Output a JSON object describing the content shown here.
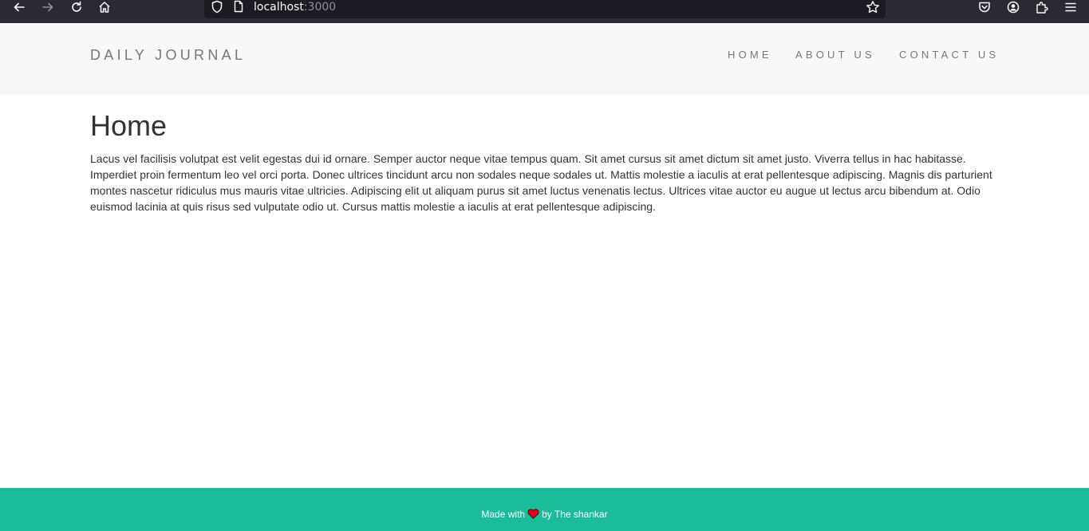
{
  "browser": {
    "url_host": "localhost",
    "url_port": ":3000"
  },
  "site": {
    "brand": "DAILY JOURNAL",
    "nav": [
      {
        "label": "HOME"
      },
      {
        "label": "ABOUT US"
      },
      {
        "label": "CONTACT US"
      }
    ]
  },
  "main": {
    "title": "Home",
    "body": "Lacus vel facilisis volutpat est velit egestas dui id ornare. Semper auctor neque vitae tempus quam. Sit amet cursus sit amet dictum sit amet justo. Viverra tellus in hac habitasse. Imperdiet proin fermentum leo vel orci porta. Donec ultrices tincidunt arcu non sodales neque sodales ut. Mattis molestie a iaculis at erat pellentesque adipiscing. Magnis dis parturient montes nascetur ridiculus mus mauris vitae ultricies. Adipiscing elit ut aliquam purus sit amet luctus venenatis lectus. Ultrices vitae auctor eu augue ut lectus arcu bibendum at. Odio euismod lacinia at quis risus sed vulputate odio ut. Cursus mattis molestie a iaculis at erat pellentesque adipiscing."
  },
  "footer": {
    "made_with": "Made with",
    "by": "by The shankar"
  },
  "colors": {
    "header_bg": "#f8f8f8",
    "footer_bg": "#1abc9c",
    "heart": "#e3001b"
  },
  "icons": [
    "back-arrow-icon",
    "forward-arrow-icon",
    "reload-icon",
    "home-icon",
    "shield-icon",
    "page-icon",
    "star-icon",
    "pocket-icon",
    "account-icon",
    "extensions-icon",
    "menu-icon",
    "heart-icon"
  ]
}
